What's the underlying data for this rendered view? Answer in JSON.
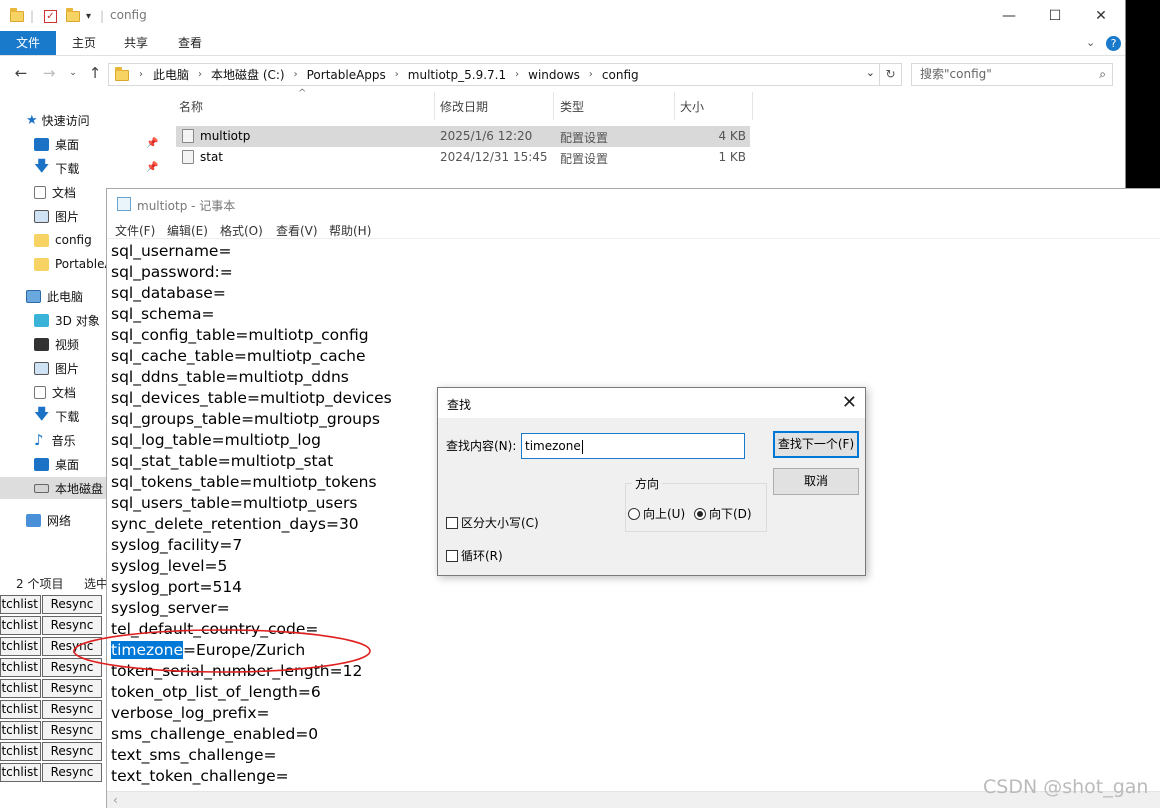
{
  "explorer": {
    "title": "config",
    "ribbon_tabs": [
      "文件",
      "主页",
      "共享",
      "查看"
    ],
    "breadcrumb": [
      "此电脑",
      "本地磁盘 (C:)",
      "PortableApps",
      "multiotp_5.9.7.1",
      "windows",
      "config"
    ],
    "search_placeholder": "搜索\"config\"",
    "nav": {
      "quick_access": "快速访问",
      "items": [
        "桌面",
        "下载",
        "文档",
        "图片",
        "config",
        "PortableA"
      ],
      "this_pc": "此电脑",
      "pc_items": [
        "3D 对象",
        "视频",
        "图片",
        "文档",
        "下载",
        "音乐",
        "桌面",
        "本地磁盘"
      ],
      "network": "网络"
    },
    "columns": [
      "名称",
      "修改日期",
      "类型",
      "大小"
    ],
    "files": [
      {
        "name": "multiotp",
        "date": "2025/1/6 12:20",
        "type": "配置设置",
        "size": "4 KB"
      },
      {
        "name": "stat",
        "date": "2024/12/31 15:45",
        "type": "配置设置",
        "size": "1 KB"
      }
    ],
    "status": {
      "count": "2 个项目",
      "selected": "选中"
    }
  },
  "background_rows": {
    "left": "tchlist",
    "right": "Resync",
    "count": 9
  },
  "notepad": {
    "title": "multiotp - 记事本",
    "menu": [
      "文件(F)",
      "编辑(E)",
      "格式(O)",
      "查看(V)",
      "帮助(H)"
    ],
    "lines": [
      "sql_username=",
      "sql_password:=",
      "sql_database=",
      "sql_schema=",
      "sql_config_table=multiotp_config",
      "sql_cache_table=multiotp_cache",
      "sql_ddns_table=multiotp_ddns",
      "sql_devices_table=multiotp_devices",
      "sql_groups_table=multiotp_groups",
      "sql_log_table=multiotp_log",
      "sql_stat_table=multiotp_stat",
      "sql_tokens_table=multiotp_tokens",
      "sql_users_table=multiotp_users",
      "sync_delete_retention_days=30",
      "syslog_facility=7",
      "syslog_level=5",
      "syslog_port=514",
      "syslog_server=",
      "tel_default_country_code=",
      "timezone=Europe/Zurich",
      "token_serial_number_length=12",
      "token_otp_list_of_length=6",
      "verbose_log_prefix=",
      "sms_challenge_enabled=0",
      "text_sms_challenge=",
      "text_token_challenge="
    ],
    "highlight": {
      "line": 19,
      "text": "timezone",
      "rest": "=Europe/Zurich"
    }
  },
  "find_dialog": {
    "title": "查找",
    "label": "查找内容(N):",
    "value": "timezone",
    "find_next": "查找下一个(F)",
    "cancel": "取消",
    "direction_label": "方向",
    "up": "向上(U)",
    "down": "向下(D)",
    "direction_selected": "down",
    "match_case": "区分大小写(C)",
    "wrap": "循环(R)"
  },
  "watermark": "CSDN @shot_gan",
  "colors": {
    "accent": "#1979ca",
    "highlight": "#0078d7",
    "annotation": "#e02020"
  }
}
